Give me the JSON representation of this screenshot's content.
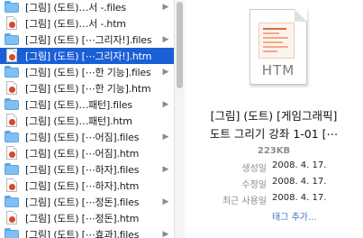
{
  "file_list": {
    "rows": [
      {
        "label": "[그림] (도트)…서 -.files",
        "kind": "folder"
      },
      {
        "label": "[그림] (도트)…서 -.htm",
        "kind": "htm"
      },
      {
        "label": "[그림] (도트) [⋯그리자!].files",
        "kind": "folder"
      },
      {
        "label": "[그림] (도트) [⋯그리자!].htm",
        "kind": "htm"
      },
      {
        "label": "[그림] (도트) [⋯한 기능].files",
        "kind": "folder"
      },
      {
        "label": "[그림] (도트) [⋯한 기능].htm",
        "kind": "htm"
      },
      {
        "label": "[그림] (도트)…패턴].files",
        "kind": "folder"
      },
      {
        "label": "[그림] (도트)…패턴].htm",
        "kind": "htm"
      },
      {
        "label": "[그림] (도트) [⋯어짐].files",
        "kind": "folder"
      },
      {
        "label": "[그림] (도트) [⋯어짐].htm",
        "kind": "htm"
      },
      {
        "label": "[그림] (도트) [⋯하자].files",
        "kind": "folder"
      },
      {
        "label": "[그림] (도트) [⋯하자].htm",
        "kind": "htm"
      },
      {
        "label": "[그림] (도트) [⋯정돈].files",
        "kind": "folder"
      },
      {
        "label": "[그림] (도트) [⋯정돈].htm",
        "kind": "htm"
      },
      {
        "label": "[그림] (도트) [⋯효과].files",
        "kind": "folder"
      }
    ],
    "selected_index": 3
  },
  "preview": {
    "icon_label": "HTM",
    "title_line1": "[그림] (도트) [게임그래픽]",
    "title_line2": "도트 그리기 강좌 1-01 [⋯",
    "size": "223KB",
    "meta": [
      {
        "key": "생성일",
        "value": "2008. 4. 17."
      },
      {
        "key": "수정일",
        "value": "2008. 4. 17."
      },
      {
        "key": "최근 사용일",
        "value": "2008. 4. 17."
      },
      {
        "key": "",
        "value": "태그 추가..."
      }
    ]
  },
  "colors": {
    "selection": "#1a5fd6",
    "folder": "#7ec0f3",
    "link": "#3b74c6"
  }
}
